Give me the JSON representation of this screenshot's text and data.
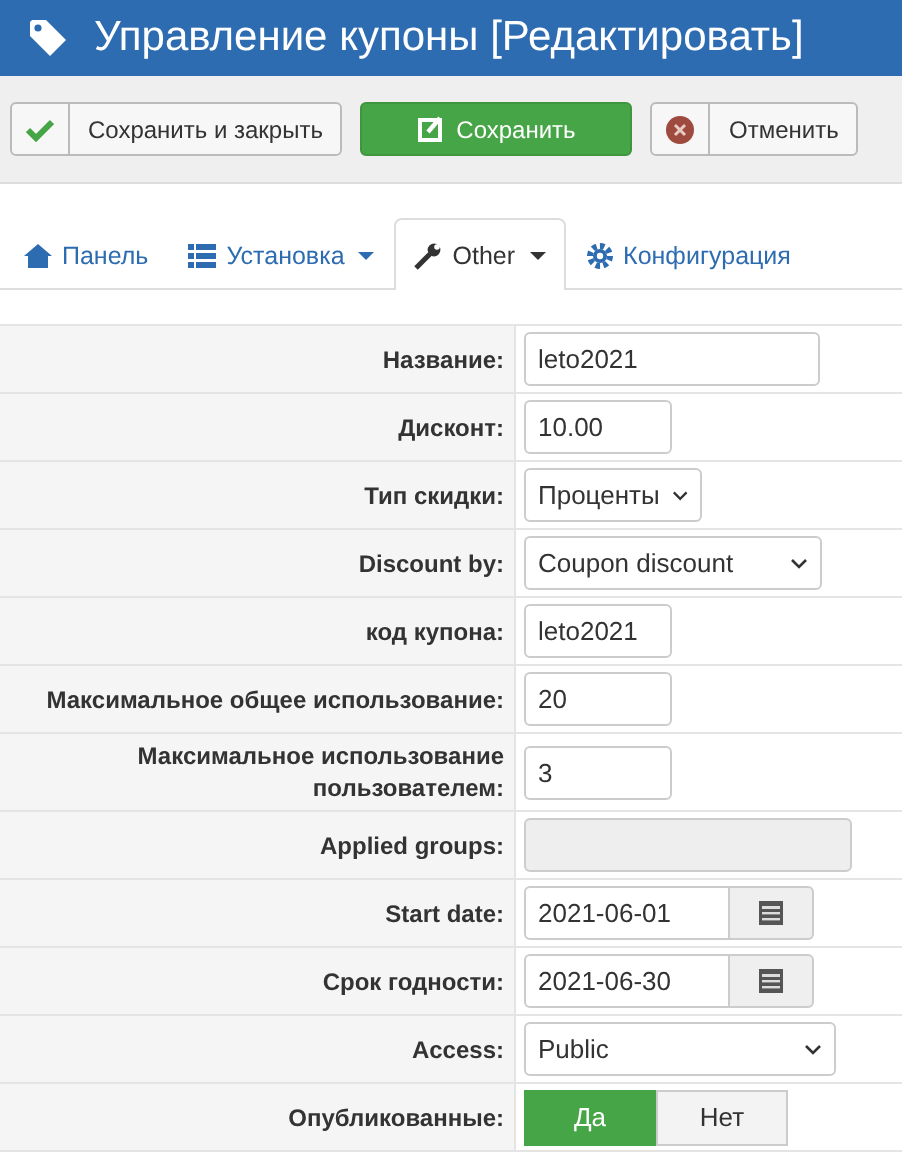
{
  "header": {
    "title": "Управление купоны [Редактировать]"
  },
  "toolbar": [
    {
      "kind": "check",
      "label": "Сохранить и закрыть"
    },
    {
      "kind": "primary",
      "label": "Сохранить"
    },
    {
      "kind": "cancel",
      "label": "Отменить"
    }
  ],
  "tabs": [
    {
      "kind": "home",
      "label": "Панель",
      "dropdown": false,
      "selected": false
    },
    {
      "kind": "list",
      "label": "Установка",
      "dropdown": true,
      "selected": false
    },
    {
      "kind": "wrench",
      "label": "Other",
      "dropdown": true,
      "selected": true
    },
    {
      "kind": "gear",
      "label": "Конфигурация",
      "dropdown": false,
      "selected": false
    }
  ],
  "fields": [
    {
      "label": "Название:",
      "kind": "text",
      "value": "leto2021"
    },
    {
      "label": "Дисконт:",
      "kind": "text",
      "value": "10.00"
    },
    {
      "label": "Тип скидки:",
      "kind": "select",
      "value": "Проценты"
    },
    {
      "label": "Discount by:",
      "kind": "select",
      "value": "Coupon discount"
    },
    {
      "label": "код купона:",
      "kind": "text",
      "value": "leto2021"
    },
    {
      "label": "Максимальное общее использование:",
      "kind": "text",
      "value": "20"
    },
    {
      "label": "Максимальное использование пользователем:",
      "kind": "text",
      "value": "3"
    },
    {
      "label": "Applied groups:",
      "kind": "disabled"
    },
    {
      "label": "Start date:",
      "kind": "date",
      "value": "2021-06-01"
    },
    {
      "label": "Срок годности:",
      "kind": "date",
      "value": "2021-06-30"
    },
    {
      "label": "Access:",
      "kind": "select",
      "value": "Public"
    },
    {
      "label": "Опубликованные:",
      "kind": "toggle",
      "options": [
        {
          "label": "Да",
          "selected": true
        },
        {
          "label": "Нет",
          "selected": false
        }
      ]
    }
  ]
}
